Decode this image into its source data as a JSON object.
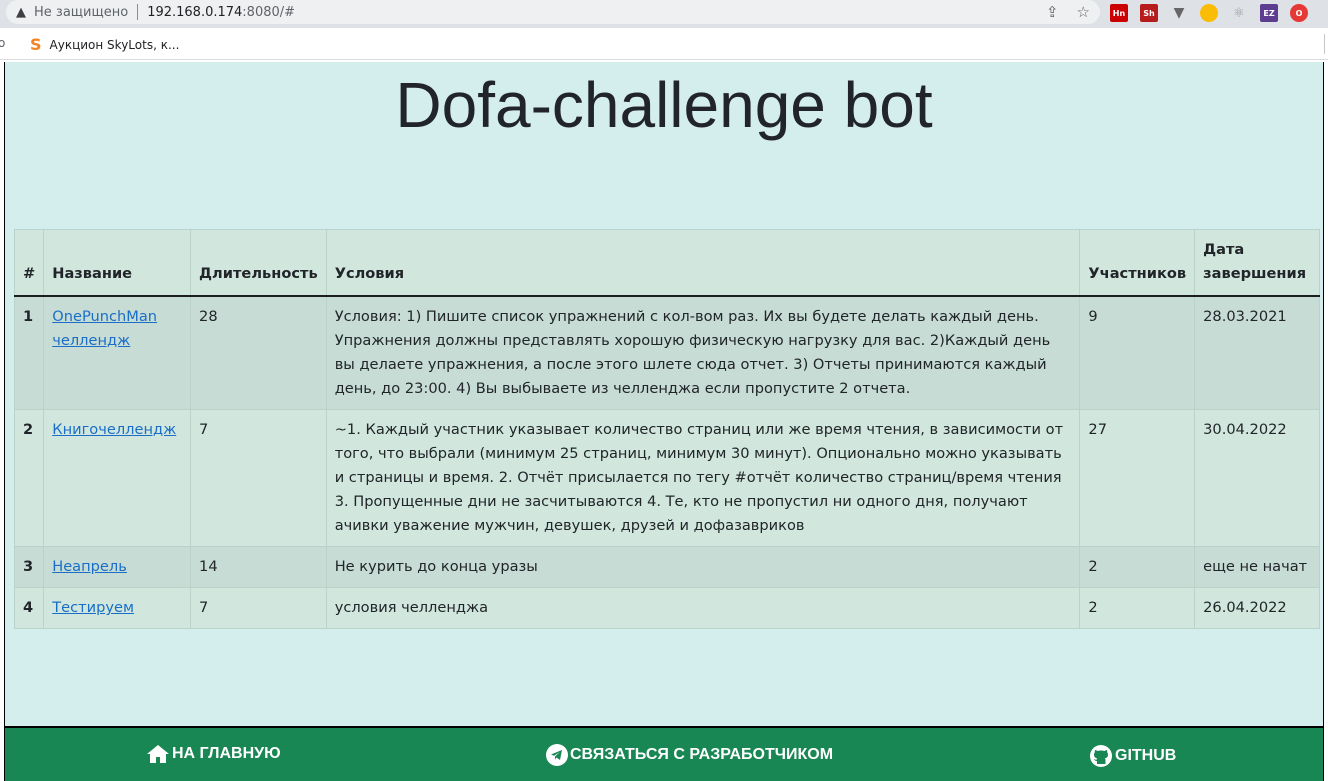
{
  "browser": {
    "security_label": "Не защищено",
    "url_host": "192.168.0.174",
    "url_rest": ":8080/#",
    "bookmark_label": "Аукцион SkyLots, к..."
  },
  "site": {
    "title": "Dofa-challenge bot"
  },
  "table": {
    "headers": [
      "#",
      "Название",
      "Длительность",
      "Условия",
      "Участников",
      "Дата завершения"
    ],
    "rows": [
      {
        "num": "1",
        "name": "OnePunchMan челлендж",
        "duration": "28",
        "conditions": "Условия: 1) Пишите список упражнений с кол-вом раз. Их вы будете делать каждый день. Упражнения должны представлять хорошую физическую нагрузку для вас. 2)Каждый день вы делаете упражнения, а после этого шлете сюда отчет. 3) Отчеты принимаются каждый день, до 23:00. 4) Вы выбываете из челленджа если пропустите 2 отчета.",
        "participants": "9",
        "end_date": "28.03.2021"
      },
      {
        "num": "2",
        "name": "Книгочеллендж",
        "duration": "7",
        "conditions": "~1. Каждый участник указывает количество страниц или же время чтения, в зависимости от того, что выбрали (минимум 25 страниц, минимум 30 минут). Опционально можно указывать и страницы и время. 2. Отчёт присылается по тегу #отчёт количество страниц/время чтения 3. Пропущенные дни не засчитываются 4. Те, кто не пропустил ни одного дня, получают ачивки уважение мужчин, девушек, друзей и дофазавриков",
        "participants": "27",
        "end_date": "30.04.2022"
      },
      {
        "num": "3",
        "name": "Неапрель",
        "duration": "14",
        "conditions": "Не курить до конца уразы",
        "participants": "2",
        "end_date": "еще не начат"
      },
      {
        "num": "4",
        "name": "Тестируем",
        "duration": "7",
        "conditions": "условия челленджа",
        "participants": "2",
        "end_date": "26.04.2022"
      }
    ]
  },
  "footer": {
    "home_label": "На главную",
    "contact_label": "Связаться с разработчиком",
    "github_label": "GitHub"
  },
  "colors": {
    "page_bg": "#d4eded",
    "table_row_odd": "#c7dcd4",
    "table_row_even": "#d1e7dd",
    "footer_bg": "#198754",
    "link": "#1a6ec8"
  }
}
